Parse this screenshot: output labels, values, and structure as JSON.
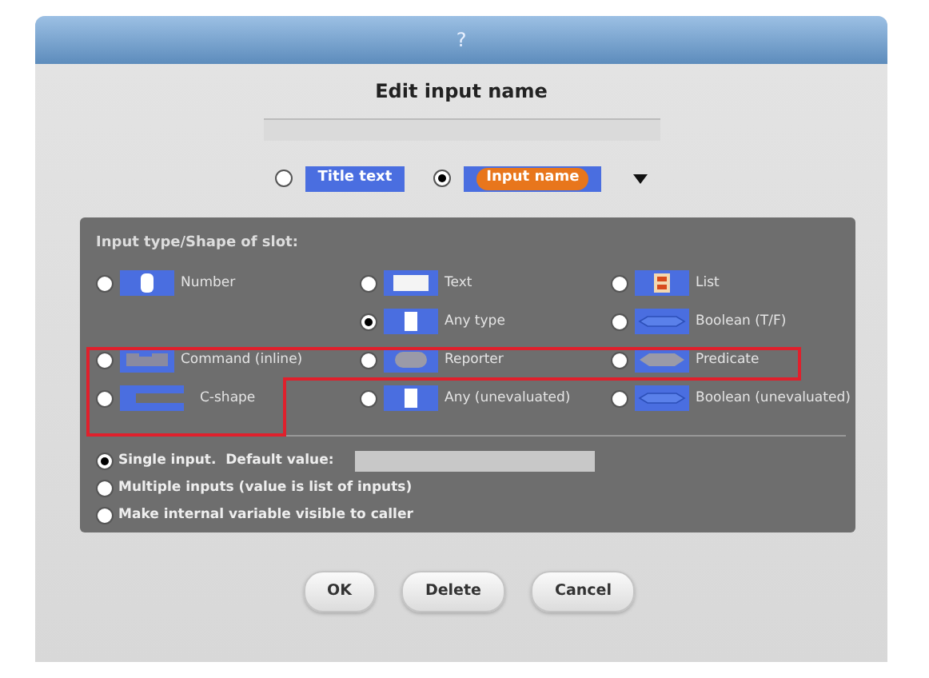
{
  "window": {
    "title": "?"
  },
  "heading": "Edit input name",
  "name_kind": [
    {
      "label": "Title text",
      "kind": "title",
      "selected": false
    },
    {
      "label": "Input name",
      "kind": "input",
      "selected": true
    }
  ],
  "panel": {
    "title": "Input type/Shape of slot:",
    "slot_rows": [
      [
        {
          "label": "Number",
          "kind": "number",
          "selected": false
        },
        {
          "label": "Text",
          "kind": "text",
          "selected": false
        },
        {
          "label": "List",
          "kind": "list",
          "selected": false
        }
      ],
      [
        {
          "label": "Any type",
          "kind": "any",
          "selected": true
        },
        {
          "label": "Boolean (T/F)",
          "kind": "boolean",
          "selected": false
        }
      ],
      [
        {
          "label": "Command (inline)",
          "kind": "command",
          "selected": false
        },
        {
          "label": "Reporter",
          "kind": "reporter",
          "selected": false
        },
        {
          "label": "Predicate",
          "kind": "predicate",
          "selected": false
        }
      ],
      [
        {
          "label": "C-shape",
          "kind": "cshape",
          "selected": false
        },
        {
          "label": "Any (unevaluated)",
          "kind": "any",
          "selected": false
        },
        {
          "label": "Boolean (unevaluated)",
          "kind": "boolean",
          "selected": false
        }
      ]
    ],
    "options": [
      {
        "label": "Single input.  Default value:",
        "kind": "default",
        "selected": true
      },
      {
        "label": "Multiple inputs (value is list of inputs)",
        "kind": "plain",
        "selected": false
      },
      {
        "label": "Make internal variable visible to caller",
        "kind": "plain",
        "selected": false
      }
    ]
  },
  "buttons": [
    "OK",
    "Delete",
    "Cancel"
  ]
}
